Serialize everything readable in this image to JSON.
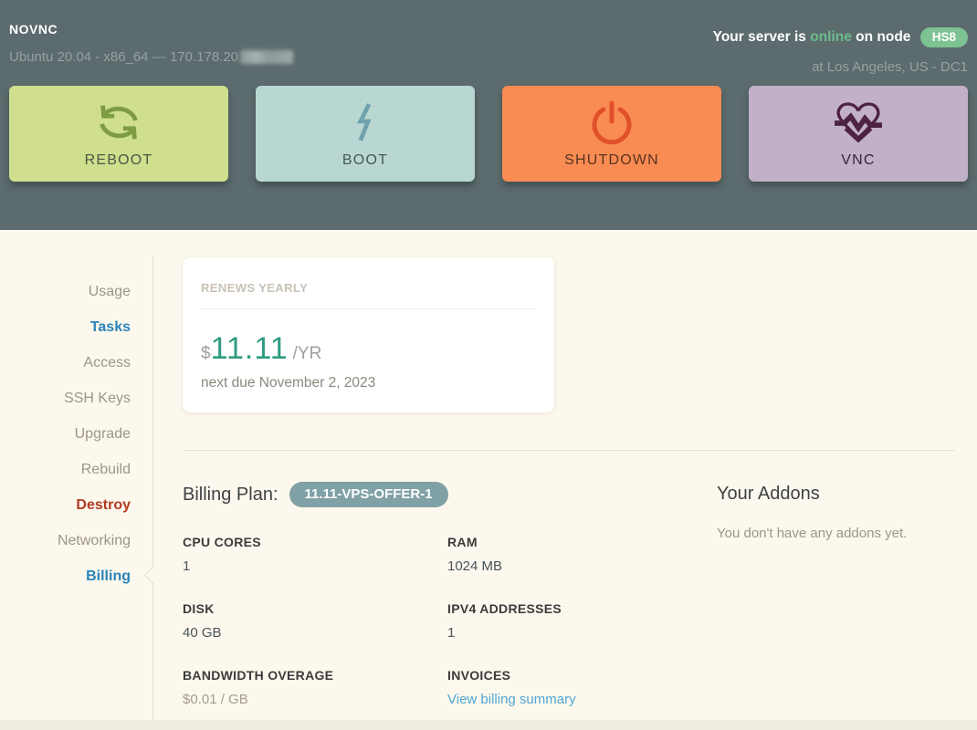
{
  "header": {
    "hostname": "NOVNC",
    "os_line": "Ubuntu 20.04 - x86_64 — 170.178.20",
    "status": {
      "prefix": "Your server is ",
      "state": "online",
      "infix": " on node",
      "node": "HS8"
    },
    "location": "at Los Angeles, US - DC1"
  },
  "actions": {
    "reboot": "REBOOT",
    "boot": "BOOT",
    "shutdown": "SHUTDOWN",
    "vnc": "VNC"
  },
  "sidebar": {
    "items": [
      {
        "label": "Usage"
      },
      {
        "label": "Tasks"
      },
      {
        "label": "Access"
      },
      {
        "label": "SSH Keys"
      },
      {
        "label": "Upgrade"
      },
      {
        "label": "Rebuild"
      },
      {
        "label": "Destroy"
      },
      {
        "label": "Networking"
      },
      {
        "label": "Billing"
      }
    ]
  },
  "billing_card": {
    "title": "RENEWS YEARLY",
    "currency": "$",
    "amount": "11.11",
    "period": "/YR",
    "next_due": "next due November 2, 2023"
  },
  "plan": {
    "heading": "Billing Plan:",
    "badge": "11.11-VPS-OFFER-1",
    "specs": [
      {
        "label": "CPU CORES",
        "value": "1"
      },
      {
        "label": "RAM",
        "value": "1024 MB"
      },
      {
        "label": "DISK",
        "value": "40 GB"
      },
      {
        "label": "IPV4 ADDRESSES",
        "value": "1"
      },
      {
        "label": "BANDWIDTH OVERAGE",
        "value": "$0.01 / GB"
      },
      {
        "label": "INVOICES",
        "value": "View billing summary"
      }
    ]
  },
  "addons": {
    "heading": "Your Addons",
    "empty_text": "You don't have any addons yet."
  },
  "colors": {
    "topbar_bg": "#5c6b6d",
    "page_bg": "#fdf8ed",
    "online_text": "#6cbd8c",
    "node_badge_bg": "#7cc293",
    "reboot_bg": "#cfdf8e",
    "boot_bg": "#b9d7d2",
    "shutdown_bg": "#f98c52",
    "vnc_bg": "#c1b0c8",
    "price_accent": "#2f9c82",
    "plan_badge_bg": "#80a1a5",
    "link": "#4fa8d5",
    "nav_active": "#2a84b8",
    "nav_danger": "#b23a24"
  }
}
